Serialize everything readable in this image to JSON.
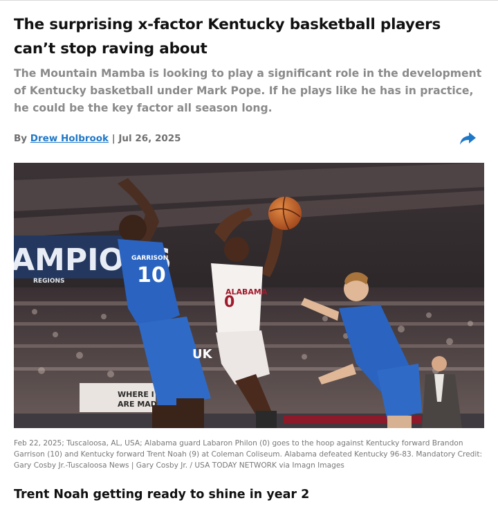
{
  "article": {
    "headline": "The surprising x-factor Kentucky basketball players can’t stop raving about",
    "dek": "The Mountain Mamba is looking to play a significant role in the development of Kentucky basketball under Mark Pope. If he plays like he has in practice, he could be the key factor all season long.",
    "byline": {
      "prefix": "By ",
      "author": "Drew Holbrook",
      "separator": " | ",
      "date": "Jul 26, 2025"
    },
    "share_icon": "share-arrow-icon",
    "photo": {
      "banner_text": "AMPIONS",
      "sponsor_text": "REGIONS",
      "sign_text": "WHERE I\nARE MAD",
      "players": [
        {
          "team": "Kentucky",
          "name": "GARRISON",
          "number": "10"
        },
        {
          "team": "Alabama",
          "name": "ALABAMA",
          "number": "0"
        },
        {
          "team": "Kentucky",
          "name": "",
          "number": ""
        }
      ]
    },
    "caption": "Feb 22, 2025; Tuscaloosa, AL, USA; Alabama guard Labaron Philon (0) goes to the hoop against Kentucky forward Brandon Garrison (10) and Kentucky forward Trent Noah (9) at Coleman Coliseum. Alabama defeated Kentucky 96-83. Mandatory Credit: Gary Cosby Jr.-Tuscaloosa News | Gary Cosby Jr. / USA TODAY NETWORK via Imagn Images",
    "subhead": "Trent Noah getting ready to shine in year 2"
  },
  "colors": {
    "link": "#1e78c8",
    "kentucky_blue": "#2a64c0",
    "alabama_crimson": "#a01a2c",
    "muted_text": "#8a8a8a"
  }
}
